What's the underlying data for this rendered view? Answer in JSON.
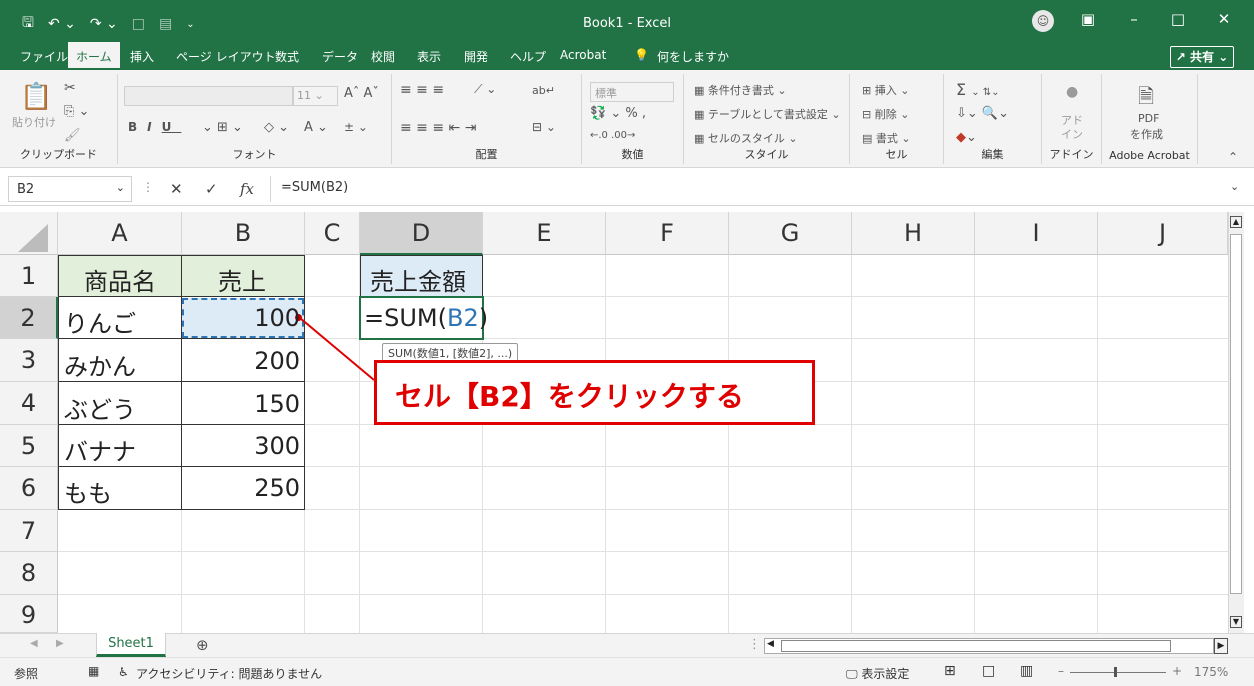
{
  "titlebar": {
    "title": "Book1  -  Excel",
    "avatar": "☺"
  },
  "tabs": [
    "ファイル",
    "ホーム",
    "挿入",
    "ページ レイアウト",
    "数式",
    "データ",
    "校閲",
    "表示",
    "開発",
    "ヘルプ",
    "Acrobat",
    "何をしますか"
  ],
  "share": "共有",
  "ribbon": {
    "clipboard": {
      "label": "クリップボード",
      "paste": "貼り付け"
    },
    "font": {
      "label": "フォント",
      "size": "11"
    },
    "align": {
      "label": "配置"
    },
    "number": {
      "label": "数値",
      "format": "標準"
    },
    "styles": {
      "label": "スタイル",
      "cond": "条件付き書式",
      "table": "テーブルとして書式設定",
      "cell": "セルのスタイル"
    },
    "cells": {
      "label": "セル",
      "insert": "挿入",
      "delete": "削除",
      "format": "書式"
    },
    "editing": {
      "label": "編集"
    },
    "addins": {
      "label": "アドイン",
      "text": "アド\nイン"
    },
    "acrobat": {
      "label": "Adobe Acrobat",
      "pdf": "PDF",
      "create": "を作成"
    }
  },
  "formula_bar": {
    "name_box": "B2",
    "cancel": "✕",
    "enter": "✓",
    "fx": "fx",
    "formula": "=SUM(B2)"
  },
  "columns": [
    "A",
    "B",
    "C",
    "D",
    "E",
    "F",
    "G",
    "H",
    "I",
    "J"
  ],
  "rows": [
    "1",
    "2",
    "3",
    "4",
    "5",
    "6",
    "7",
    "8",
    "9"
  ],
  "cells": {
    "A1": "商品名",
    "B1": "売上",
    "D1": "売上金額",
    "A2": "りんご",
    "B2": "100",
    "D2_prefix": "=SUM(",
    "D2_ref": "B2",
    "D2_suffix": ")",
    "A3": "みかん",
    "B3": "200",
    "A4": "ぶどう",
    "B4": "150",
    "A5": "バナナ",
    "B5": "300",
    "A6": "もも",
    "B6": "250"
  },
  "tooltip": "SUM(数値1, [数値2], ...)",
  "callout": "セル【B2】をクリックする",
  "sheet_tab": "Sheet1",
  "status": {
    "mode": "参照",
    "accessibility": "アクセシビリティ: 問題ありません",
    "display": "表示設定",
    "zoom": "175%"
  }
}
